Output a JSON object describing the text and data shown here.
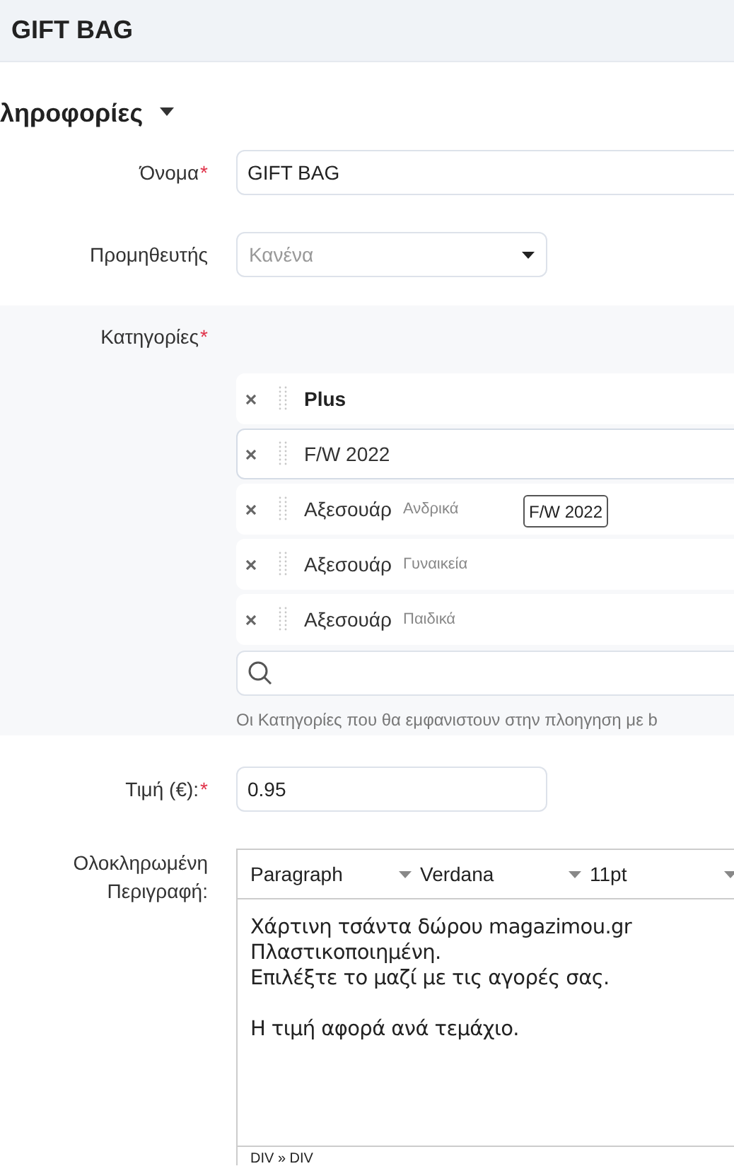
{
  "header": {
    "title": "GIFT BAG"
  },
  "section": {
    "title": "ληροφορίες",
    "expanded": true
  },
  "name_field": {
    "label": "Όνομα",
    "required_mark": "*",
    "value": "GIFT BAG"
  },
  "supplier_field": {
    "label": "Προμηθευτής",
    "placeholder": "Κανένα"
  },
  "categories": {
    "label": "Κατηγορίες",
    "required_mark": "*",
    "items": [
      {
        "kind": "parent",
        "name": "Plus",
        "highlighted": false
      },
      {
        "kind": "child",
        "name": "F/W 2022",
        "highlighted": true
      },
      {
        "kind": "child",
        "name": "Αξεσουάρ",
        "sub": "Ανδρικά",
        "highlighted": false
      },
      {
        "kind": "child",
        "name": "Αξεσουάρ",
        "sub": "Γυναικεία",
        "highlighted": false
      },
      {
        "kind": "child",
        "name": "Αξεσουάρ",
        "sub": "Παιδικά",
        "highlighted": false
      }
    ],
    "tooltip": "F/W 2022",
    "help": "Οι Κατηγορίες που θα εμφανιστουν στην πλοηγηση με b"
  },
  "price_field": {
    "label": "Τιμή (€):",
    "required_mark": "*",
    "value": "0.95"
  },
  "description": {
    "label": "Ολοκληρωμένη Περιγραφή:",
    "toolbar": [
      "Paragraph",
      "Verdana",
      "11pt"
    ],
    "paragraphs": [
      {
        "lines": [
          "Χάρτινη τσάντα δώρου magazimou.gr",
          "Πλαστικοποιημένη.",
          "Επιλέξτε το μαζί με τις αγορές σας."
        ]
      },
      {
        "lines": [
          "Η τιμή αφορά ανά τεμάχιο."
        ]
      }
    ],
    "status": "DIV » DIV"
  }
}
